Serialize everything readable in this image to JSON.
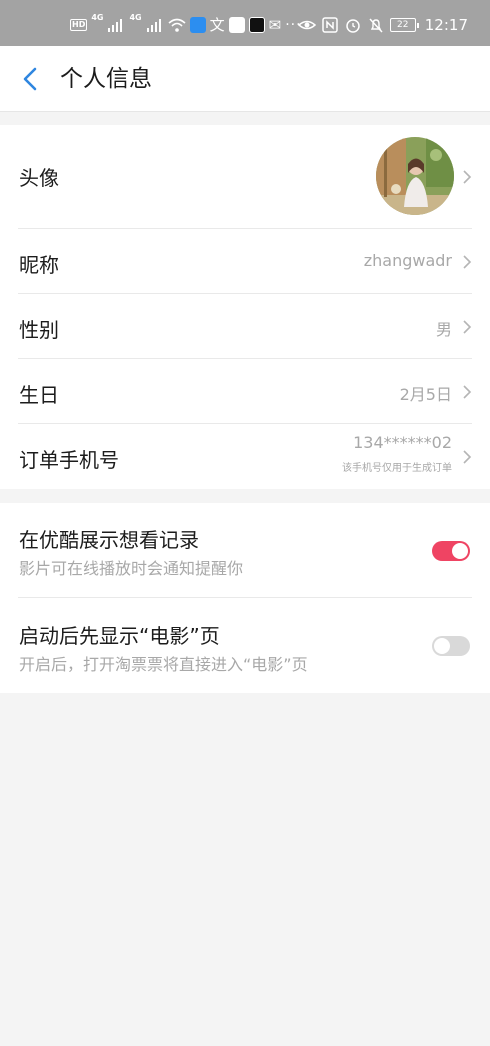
{
  "status_bar": {
    "hd_label": "HD",
    "sim1_label": "4G",
    "sim2_label": "4G",
    "battery_level": "22",
    "time": "12:17"
  },
  "header": {
    "title": "个人信息"
  },
  "profile": {
    "avatar_label": "头像",
    "nickname_label": "昵称",
    "nickname_value": "zhangwadr",
    "gender_label": "性别",
    "gender_value": "男",
    "birthday_label": "生日",
    "birthday_value": "2月5日",
    "phone_label": "订单手机号",
    "phone_value": "134******02",
    "phone_note": "该手机号仅用于生成订单"
  },
  "settings": {
    "watch_history_title": "在优酷展示想看记录",
    "watch_history_desc": "影片可在线播放时会通知提醒你",
    "watch_history_enabled": true,
    "movie_page_title": "启动后先显示“电影”页",
    "movie_page_desc": "开启后，打开淘票票将直接进入“电影”页",
    "movie_page_enabled": false
  },
  "colors": {
    "accent_blue": "#2f86e0",
    "toggle_on": "#ef4463",
    "toggle_off": "#d9d9d9"
  }
}
